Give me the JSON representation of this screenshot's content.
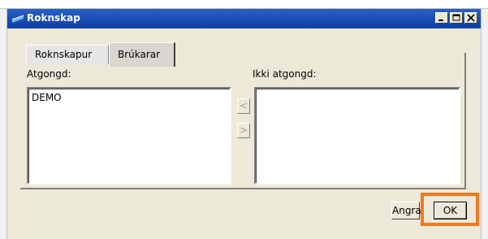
{
  "window": {
    "title": "Rokn­skap"
  },
  "tabs": [
    {
      "label": "Roknskapur"
    },
    {
      "label": "Brúkarar"
    }
  ],
  "lists": {
    "left_label": "Atgongd:",
    "right_label": "Ikki atgongd:",
    "left_items": [
      "DEMO"
    ],
    "right_items": []
  },
  "arrows": {
    "left": "<",
    "right": ">"
  },
  "buttons": {
    "cancel": "Angra",
    "ok": "OK"
  },
  "colors": {
    "titlebar": "#0a3fa6",
    "highlight": "#f07a1e"
  },
  "icons": {
    "title": "app-icon",
    "minimize": "minimize-icon",
    "maximize": "maximize-icon",
    "close": "close-icon"
  }
}
